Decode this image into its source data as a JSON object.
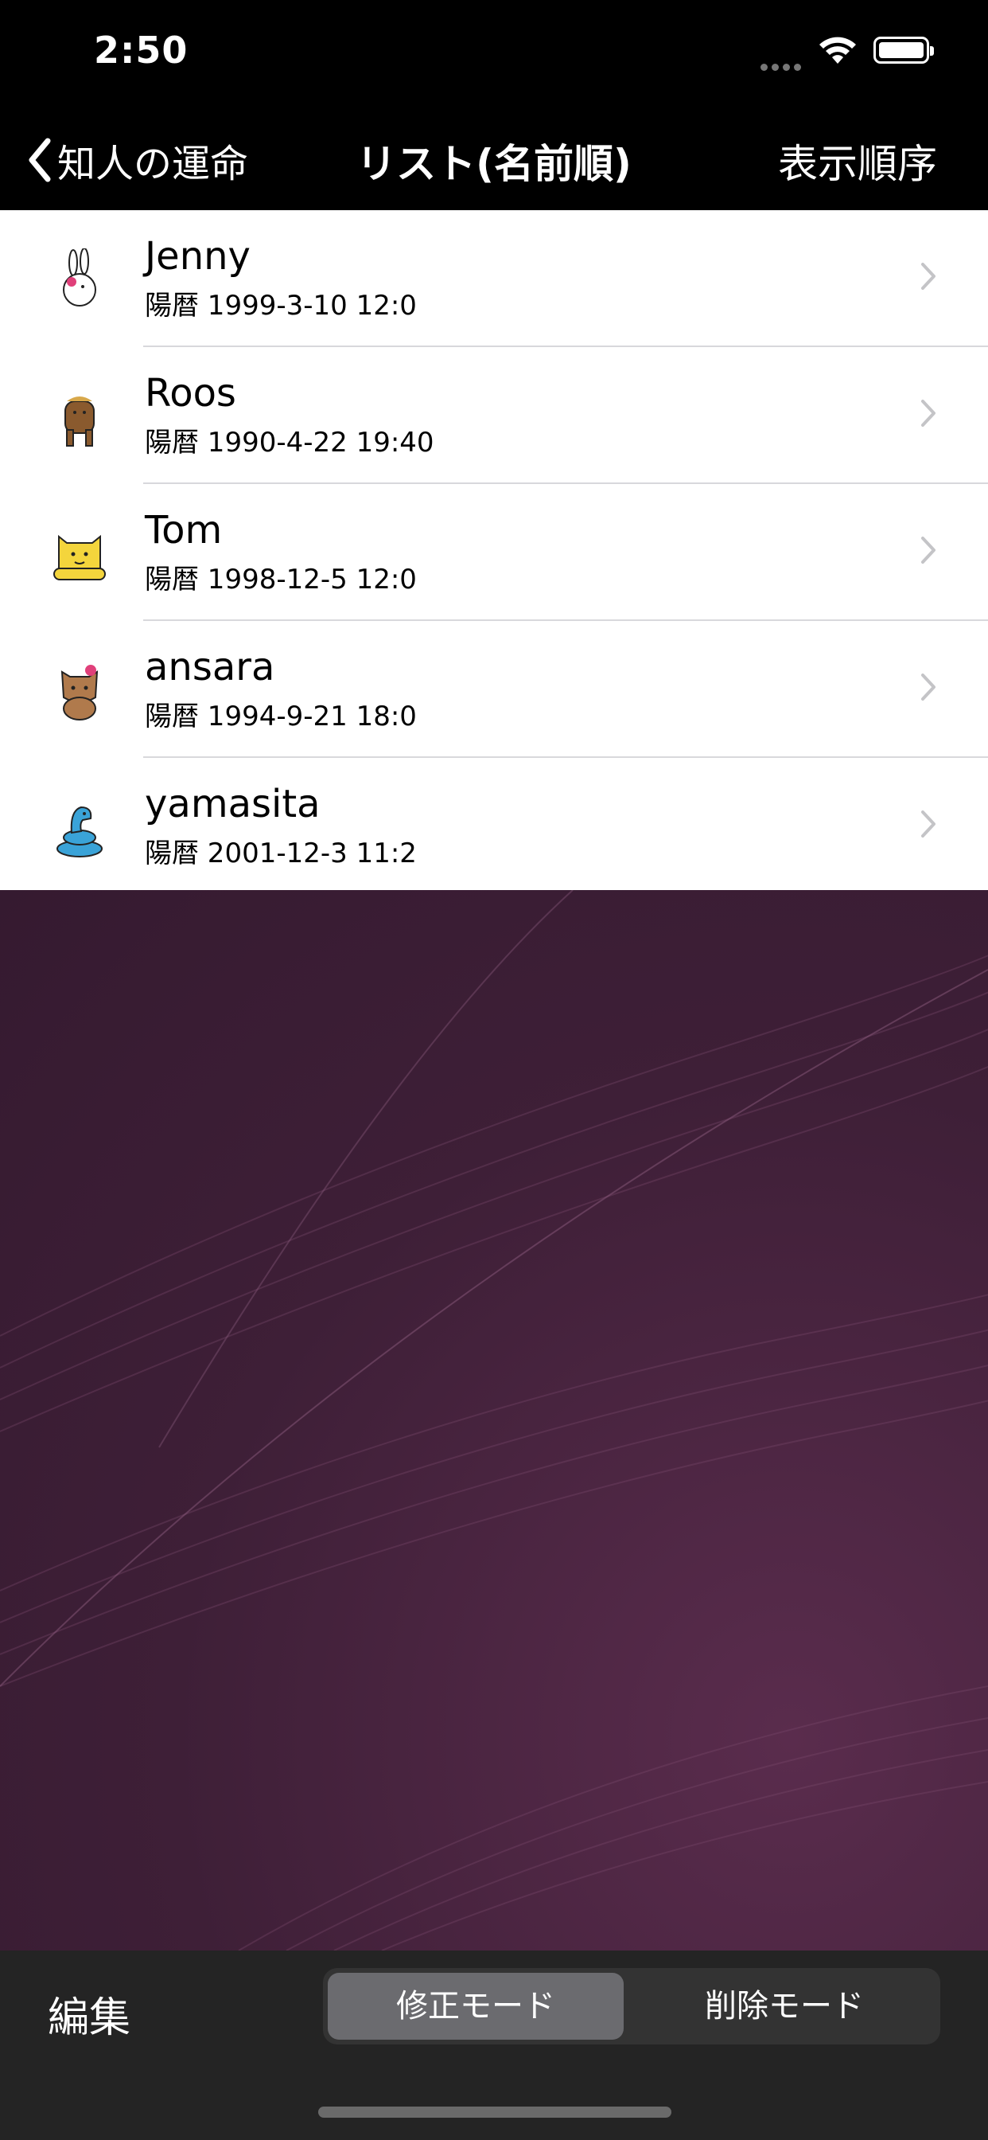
{
  "status": {
    "time": "2:50"
  },
  "nav": {
    "back_label": "知人の運命",
    "title": "リスト(名前順)",
    "right_label": "表示順序"
  },
  "list": [
    {
      "name": "Jenny",
      "date": "陽暦 1999-3-10 12:0",
      "icon": "rabbit-icon"
    },
    {
      "name": "Roos",
      "date": "陽暦 1990-4-22 19:40",
      "icon": "horse-icon"
    },
    {
      "name": "Tom",
      "date": "陽暦 1998-12-5 12:0",
      "icon": "tiger-icon"
    },
    {
      "name": "ansara",
      "date": "陽暦 1994-9-21 18:0",
      "icon": "dog-icon"
    },
    {
      "name": "yamasita",
      "date": "陽暦 2001-12-3 11:2",
      "icon": "snake-icon"
    }
  ],
  "toolbar": {
    "edit_label": "編集",
    "modes": [
      "修正モード",
      "削除モード"
    ],
    "selected_mode": "修正モード"
  }
}
